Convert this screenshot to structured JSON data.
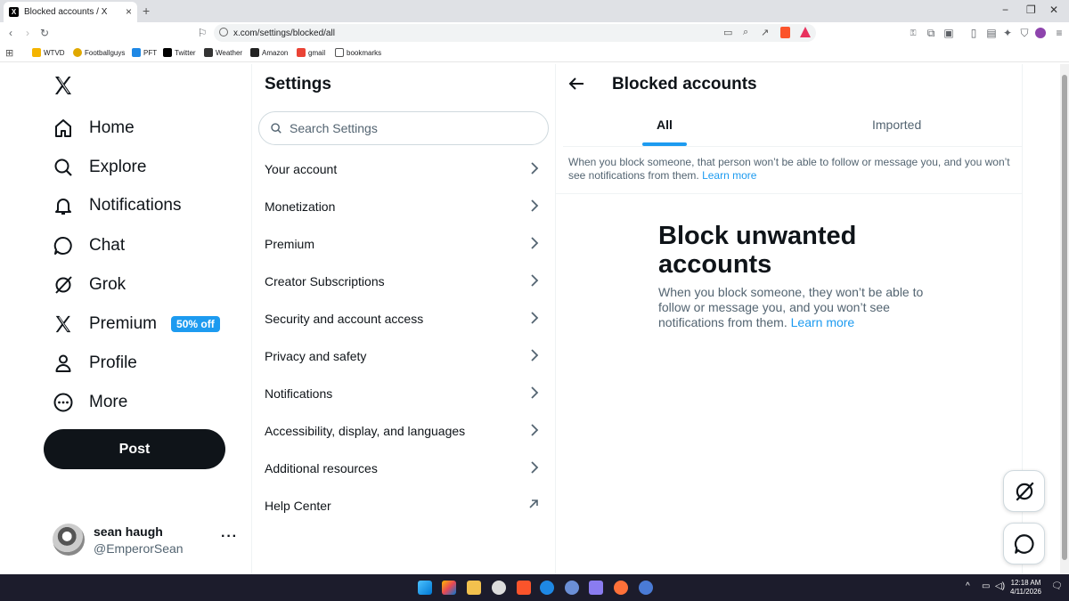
{
  "browser": {
    "tab_title": "Blocked accounts / X",
    "tab_favicon": "X",
    "url": "x.com/settings/blocked/all",
    "bookmarks": [
      {
        "label": "WTVD",
        "color": "#f4b400"
      },
      {
        "label": "Footballguys",
        "color": "#e0a800"
      },
      {
        "label": "PFT",
        "color": "#1e88e5"
      },
      {
        "label": "Twitter",
        "color": "#000000"
      },
      {
        "label": "Weather",
        "color": "#333333"
      },
      {
        "label": "Amazon",
        "color": "#222222"
      },
      {
        "label": "gmail",
        "color": "#ea4335"
      },
      {
        "label": "bookmarks",
        "color": "#ffffff"
      }
    ]
  },
  "nav": {
    "items": [
      {
        "label": "Home",
        "icon": "home-icon"
      },
      {
        "label": "Explore",
        "icon": "search-icon"
      },
      {
        "label": "Notifications",
        "icon": "bell-icon"
      },
      {
        "label": "Chat",
        "icon": "chat-icon"
      },
      {
        "label": "Grok",
        "icon": "grok-icon"
      },
      {
        "label": "Premium",
        "icon": "x-logo-icon"
      },
      {
        "label": "Profile",
        "icon": "person-icon"
      },
      {
        "label": "More",
        "icon": "more-circle-icon"
      }
    ],
    "premium_badge": "50% off",
    "post_label": "Post"
  },
  "user": {
    "name": "sean haugh",
    "handle": "@EmperorSean"
  },
  "settings": {
    "title": "Settings",
    "search_placeholder": "Search Settings",
    "items": [
      {
        "label": "Your account",
        "icon": "chevron-right-icon"
      },
      {
        "label": "Monetization",
        "icon": "chevron-right-icon"
      },
      {
        "label": "Premium",
        "icon": "chevron-right-icon"
      },
      {
        "label": "Creator Subscriptions",
        "icon": "chevron-right-icon"
      },
      {
        "label": "Security and account access",
        "icon": "chevron-right-icon"
      },
      {
        "label": "Privacy and safety",
        "icon": "chevron-right-icon"
      },
      {
        "label": "Notifications",
        "icon": "chevron-right-icon"
      },
      {
        "label": "Accessibility, display, and languages",
        "icon": "chevron-right-icon"
      },
      {
        "label": "Additional resources",
        "icon": "chevron-right-icon"
      },
      {
        "label": "Help Center",
        "icon": "external-link-icon"
      }
    ]
  },
  "main": {
    "title": "Blocked accounts",
    "tabs": [
      {
        "label": "All",
        "active": true
      },
      {
        "label": "Imported",
        "active": false
      }
    ],
    "info_text": "When you block someone, that person won’t be able to follow or message you, and you won’t see notifications from them.",
    "info_link": "Learn more",
    "empty_title": "Block unwanted accounts",
    "empty_desc": "When you block someone, they won’t be able to follow or message you, and you won’t see notifications from them.",
    "empty_link": "Learn more"
  },
  "taskbar": {
    "time": "12:18 AM",
    "date": "4/11/2026"
  },
  "colors": {
    "accent": "#1d9bf0",
    "text": "#0f1419",
    "secondary_text": "#536471"
  }
}
